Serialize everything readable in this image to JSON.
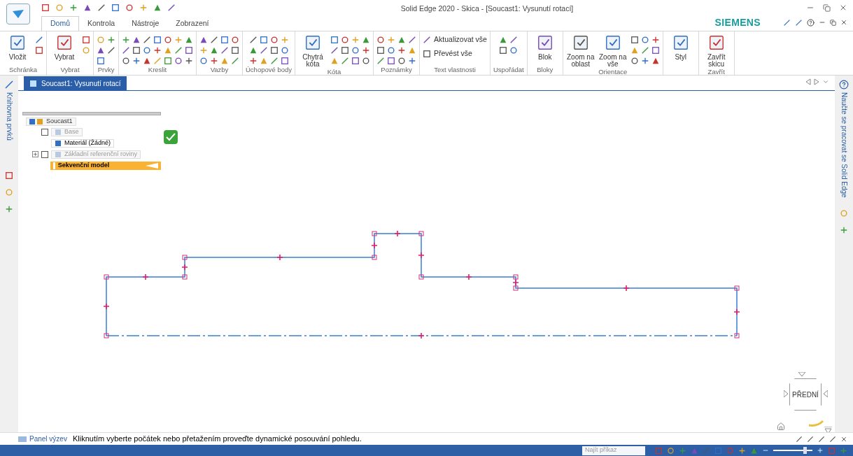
{
  "window": {
    "title": "Solid Edge 2020 - Skica - [Soucast1: Vysunutí rotací]",
    "brand": "SIEMENS"
  },
  "tabs": [
    {
      "label": "Domů",
      "selected": true
    },
    {
      "label": "Kontrola",
      "selected": false
    },
    {
      "label": "Nástroje",
      "selected": false
    },
    {
      "label": "Zobrazení",
      "selected": false
    }
  ],
  "ribbon_groups": [
    {
      "label": "Schránka",
      "buttons": [
        {
          "label": "Vložit",
          "kind": "large"
        }
      ]
    },
    {
      "label": "Vybrat",
      "buttons": [
        {
          "label": "Vybrat",
          "kind": "large"
        }
      ]
    },
    {
      "label": "Prvky"
    },
    {
      "label": "Kreslit"
    },
    {
      "label": "Vazby"
    },
    {
      "label": "Úchopové body"
    },
    {
      "label": "Kóta",
      "buttons": [
        {
          "label": "Chytrá kóta",
          "kind": "large"
        }
      ]
    },
    {
      "label": "Poznámky"
    },
    {
      "label": "Text vlastnosti",
      "buttons": [
        {
          "label": "Aktualizovat vše",
          "kind": "small"
        },
        {
          "label": "Převést vše",
          "kind": "small"
        }
      ]
    },
    {
      "label": "Uspořádat"
    },
    {
      "label": "Bloky",
      "buttons": [
        {
          "label": "Blok",
          "kind": "large"
        }
      ]
    },
    {
      "label": "Orientace",
      "buttons": [
        {
          "label": "Zoom na oblast",
          "kind": "large"
        },
        {
          "label": "Zoom na vše",
          "kind": "large"
        }
      ]
    },
    {
      "buttons": [
        {
          "label": "Styl",
          "kind": "large"
        }
      ]
    },
    {
      "label": "Zavřít",
      "buttons": [
        {
          "label": "Zavřít skicu",
          "kind": "large"
        }
      ]
    }
  ],
  "document_tab": {
    "label": "Soucast1: Vysunutí rotací"
  },
  "left_panel": {
    "label": "Knihovna prvků"
  },
  "right_panel": {
    "label": "Naučte se pracovat se Solid Edge"
  },
  "tree": {
    "label": "Soucast1",
    "children": [
      {
        "label": "Base",
        "kind": "checkbox",
        "checked": false,
        "dimmed": true,
        "selected": false
      },
      {
        "label": "Materiál (Žádné)",
        "kind": "plain",
        "dimmed": false,
        "selected": false
      },
      {
        "label": "Základní referenční roviny",
        "kind": "checkbox",
        "checked": false,
        "dimmed": true,
        "expanded": false,
        "selected": false
      },
      {
        "label": "Sekvenční model",
        "kind": "marker",
        "dimmed": false,
        "selected": true
      }
    ]
  },
  "view_cube": {
    "label": "PŘEDNÍ"
  },
  "prompt_bar": {
    "label": "Panel výzev",
    "message": "Kliknutím vyberte počátek nebo přetažením proveďte dynamické posouvání pohledu."
  },
  "status_bar": {
    "search": {
      "placeholder": "Najít příkaz"
    },
    "zoom_slider": {
      "level": 0.8
    }
  }
}
